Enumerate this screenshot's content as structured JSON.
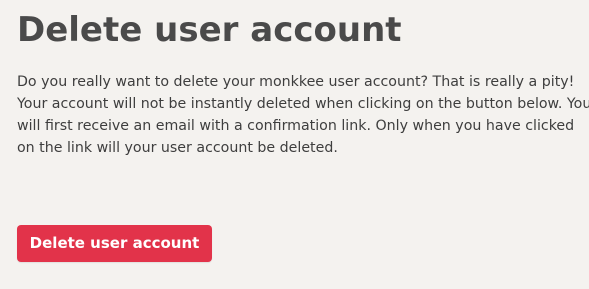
{
  "page": {
    "title": "Delete user account",
    "description": "Do you really want to delete your monkkee user account? That is really a pity! Your account will not be instantly deleted when clicking on the button below. You will first receive an email with a confirmation link. Only when you have clicked on the link will your user account be deleted.",
    "delete_button_label": "Delete user account"
  },
  "colors": {
    "background": "#f4f2ef",
    "button_bg": "#e2334a",
    "button_text": "#ffffff",
    "title_text": "#4a4a4a",
    "body_text": "#3e3e3e"
  }
}
